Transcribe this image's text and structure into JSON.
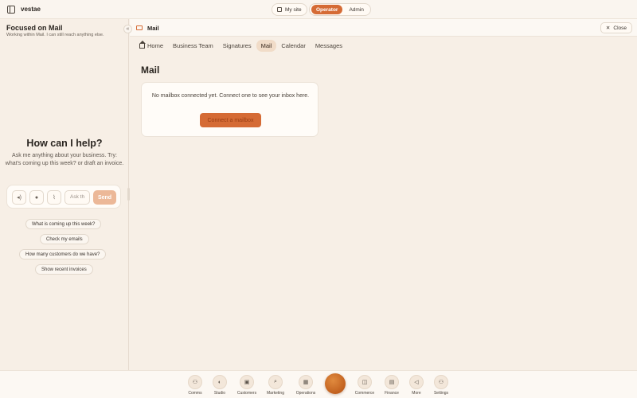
{
  "topbar": {
    "brand": "vestae",
    "my_site_label": "My site",
    "modes": [
      "Operator",
      "Admin"
    ],
    "active_mode": "Operator"
  },
  "chat": {
    "title": "Focused on Mail",
    "subtitle": "Working within Mail. I can still reach anything else.",
    "help_title": "How can I help?",
    "help_text": "Ask me anything about your business. Try: what's coming up this week? or draft an invoice.",
    "input_placeholder": "Ask th",
    "send_label": "Send",
    "suggestions": [
      "What is coming up this week?",
      "Check my emails",
      "How many customers do we have?",
      "Show recent invoices"
    ]
  },
  "main": {
    "header_title": "Mail",
    "close_label": "Close",
    "tabs": [
      "Home",
      "Business Team",
      "Signatures",
      "Mail",
      "Calendar",
      "Messages"
    ],
    "active_tab": "Mail",
    "page_title": "Mail",
    "empty_message": "No mailbox connected yet. Connect one to see your inbox here.",
    "connect_label": "Connect a mailbox"
  },
  "dock": {
    "items": [
      "Comms",
      "Studio",
      "Customers",
      "Marketing",
      "Operations",
      "Commerce",
      "Finance",
      "More",
      "Settings"
    ]
  },
  "colors": {
    "accent": "#d56b35",
    "background": "#f7efe6"
  }
}
